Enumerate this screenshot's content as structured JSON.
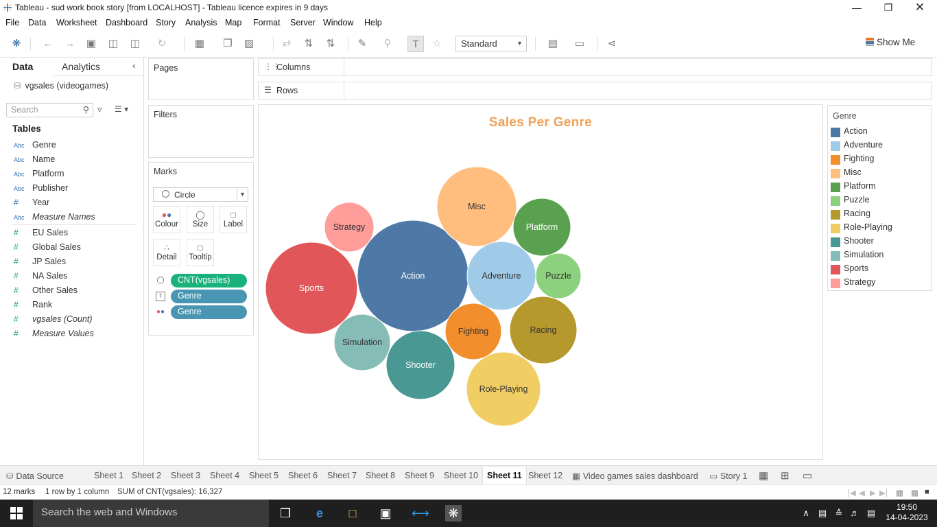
{
  "window": {
    "title": "Tableau - sud work book story [from LOCALHOST] - Tableau licence expires in 9 days",
    "minimize_icon": "minimize-icon",
    "maximize_icon": "restore-icon",
    "close_icon": "close-icon"
  },
  "menu": [
    "File",
    "Data",
    "Worksheet",
    "Dashboard",
    "Story",
    "Analysis",
    "Map",
    "Format",
    "Server",
    "Window",
    "Help"
  ],
  "toolbar": {
    "fit_value": "Standard",
    "show_me": "Show Me"
  },
  "data_pane": {
    "tab_data": "Data",
    "tab_analytics": "Analytics",
    "datasource": "vgsales (videogames)",
    "search_placeholder": "Search",
    "tables_heading": "Tables",
    "dimensions": [
      {
        "type": "Abc",
        "name": "Genre"
      },
      {
        "type": "Abc",
        "name": "Name"
      },
      {
        "type": "Abc",
        "name": "Platform"
      },
      {
        "type": "Abc",
        "name": "Publisher"
      },
      {
        "type": "#",
        "name": "Year"
      },
      {
        "type": "Abc",
        "name": "Measure Names"
      }
    ],
    "measures": [
      {
        "type": "#",
        "name": "EU Sales"
      },
      {
        "type": "#",
        "name": "Global Sales"
      },
      {
        "type": "#",
        "name": "JP Sales"
      },
      {
        "type": "#",
        "name": "NA Sales"
      },
      {
        "type": "#",
        "name": "Other Sales"
      },
      {
        "type": "#",
        "name": "Rank"
      },
      {
        "type": "#",
        "name": "vgsales (Count)"
      },
      {
        "type": "#",
        "name": "Measure Values"
      }
    ]
  },
  "cards": {
    "pages": "Pages",
    "filters": "Filters",
    "marks": "Marks",
    "mark_type": "Circle",
    "mark_buttons": [
      "Colour",
      "Size",
      "Label",
      "Detail",
      "Tooltip"
    ],
    "pills": [
      {
        "label": "CNT(vgsales)",
        "color": "#1ab27c",
        "icon": "size-icon"
      },
      {
        "label": "Genre",
        "color": "#4996b2",
        "icon": "label-icon"
      },
      {
        "label": "Genre",
        "color": "#4996b2",
        "icon": "colour-icon"
      }
    ]
  },
  "shelves": {
    "columns": "Columns",
    "rows": "Rows"
  },
  "viz": {
    "title": "Sales Per Genre"
  },
  "chart_data": {
    "type": "packed-bubble",
    "title": "Sales Per Genre",
    "measure": "CNT(vgsales)",
    "total": "16,327",
    "bubbles": [
      {
        "label": "Action",
        "color": "#4e79a7"
      },
      {
        "label": "Sports",
        "color": "#e15759"
      },
      {
        "label": "Misc",
        "color": "#ffbe7d"
      },
      {
        "label": "Role-Playing",
        "color": "#f1ce63"
      },
      {
        "label": "Shooter",
        "color": "#499894"
      },
      {
        "label": "Adventure",
        "color": "#a0cbe8"
      },
      {
        "label": "Racing",
        "color": "#b6992d"
      },
      {
        "label": "Platform",
        "color": "#59a14f"
      },
      {
        "label": "Simulation",
        "color": "#86bcb6"
      },
      {
        "label": "Fighting",
        "color": "#f28e2b"
      },
      {
        "label": "Strategy",
        "color": "#ff9d9a"
      },
      {
        "label": "Puzzle",
        "color": "#8cd17d"
      }
    ]
  },
  "legend": {
    "title": "Genre",
    "items": [
      {
        "label": "Action",
        "color": "#4e79a7"
      },
      {
        "label": "Adventure",
        "color": "#a0cbe8"
      },
      {
        "label": "Fighting",
        "color": "#f28e2b"
      },
      {
        "label": "Misc",
        "color": "#ffbe7d"
      },
      {
        "label": "Platform",
        "color": "#59a14f"
      },
      {
        "label": "Puzzle",
        "color": "#8cd17d"
      },
      {
        "label": "Racing",
        "color": "#b6992d"
      },
      {
        "label": "Role-Playing",
        "color": "#f1ce63"
      },
      {
        "label": "Shooter",
        "color": "#499894"
      },
      {
        "label": "Simulation",
        "color": "#86bcb6"
      },
      {
        "label": "Sports",
        "color": "#e15759"
      },
      {
        "label": "Strategy",
        "color": "#ff9d9a"
      }
    ]
  },
  "sheet_tabs": {
    "data_source": "Data Source",
    "sheets": [
      "Sheet 1",
      "Sheet 2",
      "Sheet 3",
      "Sheet 4",
      "Sheet 5",
      "Sheet 6",
      "Sheet 7",
      "Sheet 8",
      "Sheet 9",
      "Sheet 10",
      "Sheet 11",
      "Sheet 12"
    ],
    "active": "Sheet 11",
    "dashboard": "Video  games sales dashboard",
    "story": "Story 1"
  },
  "status": {
    "marks": "12 marks",
    "dims": "1 row by 1 column",
    "sum": "SUM of CNT(vgsales): 16,327"
  },
  "taskbar": {
    "search": "Search the web and Windows",
    "time": "19:50",
    "date": "14-04-2023"
  }
}
